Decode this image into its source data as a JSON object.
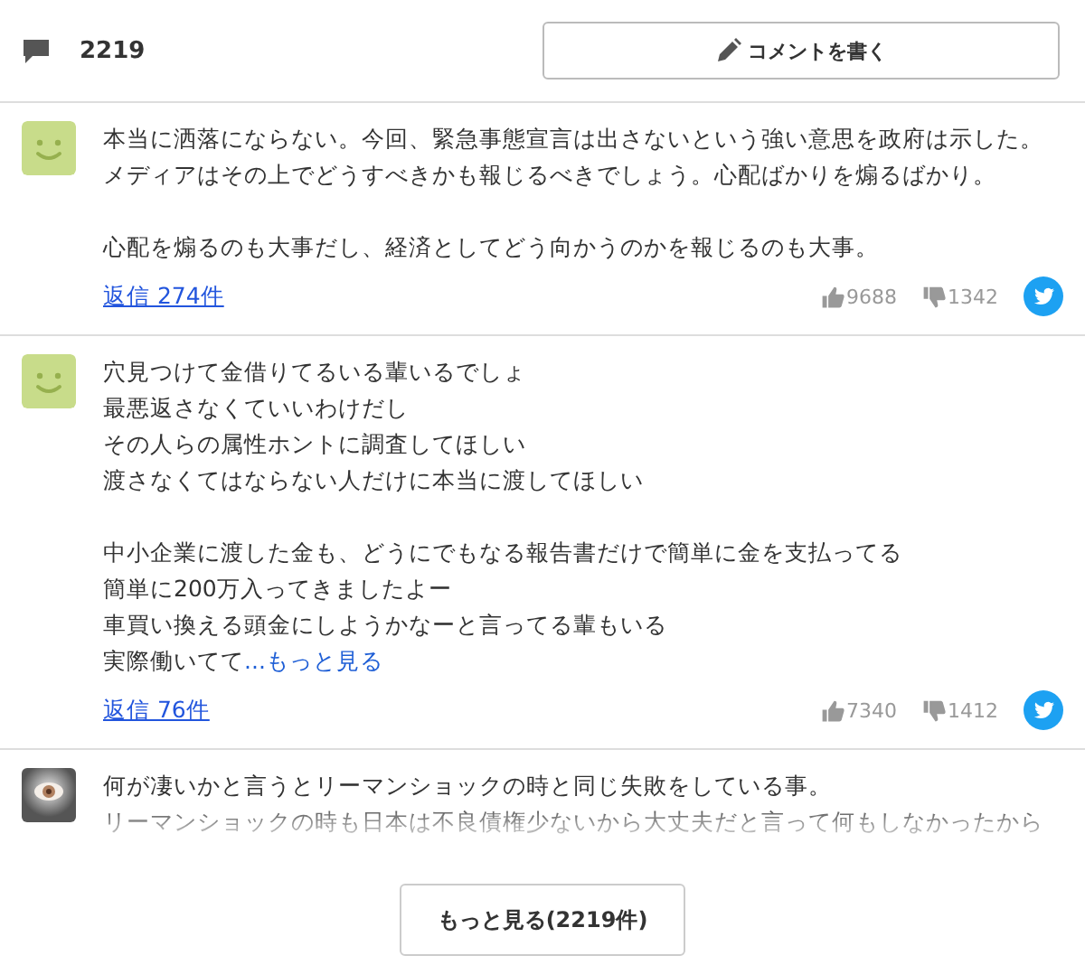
{
  "header": {
    "comment_count": "2219",
    "write_button": "コメントを書く"
  },
  "comments": [
    {
      "kind": "smiley",
      "paragraphs": [
        [
          "本当に洒落にならない。今回、緊急事態宣言は出さないという強い意思を政府は示した。",
          "メディアはその上でどうすべきかも報じるべきでしょう。心配ばかりを煽るばかり。"
        ],
        [
          "心配を煽るのも大事だし、経済としてどう向かうのかを報じるのも大事。"
        ]
      ],
      "replies": "返信 274件",
      "likes": "9688",
      "dislikes": "1342",
      "faded": false
    },
    {
      "kind": "smiley",
      "paragraphs": [
        [
          "穴見つけて金借りてるいる輩いるでしょ",
          "最悪返さなくていいわけだし",
          "その人らの属性ホントに調査してほしい",
          "渡さなくてはならない人だけに本当に渡してほしい"
        ],
        [
          "中小企業に渡した金も、どうにでもなる報告書だけで簡単に金を支払ってる",
          "簡単に200万入ってきましたよー",
          "車買い換える頭金にしようかなーと言ってる輩もいる",
          "実際働いてて"
        ]
      ],
      "more_link": "...もっと見る",
      "replies": "返信 76件",
      "likes": "7340",
      "dislikes": "1412",
      "faded": false
    },
    {
      "kind": "picture",
      "paragraphs": [
        [
          "何が凄いかと言うとリーマンショックの時と同じ失敗をしている事。",
          "リーマンショックの時も日本は不良債権少ないから大丈夫だと言って何もしなかったから"
        ]
      ],
      "faded": true
    }
  ],
  "load_more": "もっと見る(2219件)"
}
